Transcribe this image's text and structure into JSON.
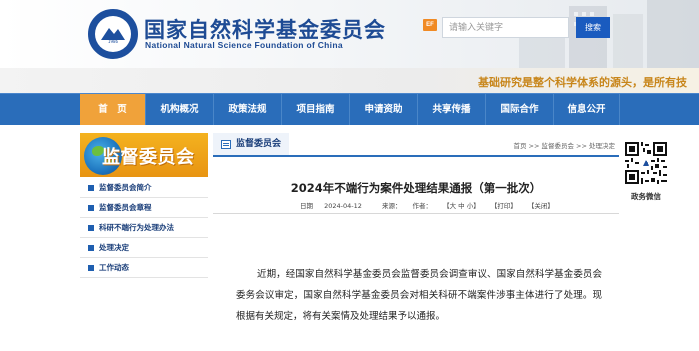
{
  "header": {
    "title_cn": "国家自然科学基金委员会",
    "title_en": "National Natural Science Foundation of China",
    "emblem_year": "1986",
    "ef_badge": "EF",
    "search": {
      "placeholder": "请输入关键字",
      "button_label": "搜索"
    }
  },
  "slogan": "基础研究是整个科学体系的源头，是所有技",
  "nav": {
    "items": [
      {
        "label": "首　页",
        "active": true
      },
      {
        "label": "机构概况"
      },
      {
        "label": "政策法规"
      },
      {
        "label": "项目指南"
      },
      {
        "label": "申请资助"
      },
      {
        "label": "共享传播"
      },
      {
        "label": "国际合作"
      },
      {
        "label": "信息公开"
      }
    ]
  },
  "sidebar": {
    "banner_title": "监督委员会",
    "items": [
      {
        "label": "监督委员会简介"
      },
      {
        "label": "监督委员会章程"
      },
      {
        "label": "科研不端行为处理办法"
      },
      {
        "label": "处理决定"
      },
      {
        "label": "工作动态"
      }
    ]
  },
  "main": {
    "section_tab": "监督委员会",
    "breadcrumb": "首页 >> 监督委员会 >> 处理决定",
    "article": {
      "title": "2024年不端行为案件处理结果通报（第一批次）",
      "date_label": "日期",
      "date": "2024-04-12",
      "source_label": "来源：",
      "author_label": "作者：",
      "font_size_control": "【大 中 小】",
      "print_control": "【打印】",
      "close_control": "【关闭】",
      "body": "近期，经国家自然科学基金委员会监督委员会调查审议、国家自然科学基金委员会委务会议审定，国家自然科学基金委员会对相关科研不端案件涉事主体进行了处理。现根据有关规定，将有关案情及处理结果予以通报。"
    }
  },
  "right": {
    "qr_label": "政务微信"
  },
  "colors": {
    "brand_blue": "#1e4b94",
    "nav_blue": "#2a6dba",
    "nav_active": "#f0a23a",
    "slogan_gold": "#c8861b"
  }
}
